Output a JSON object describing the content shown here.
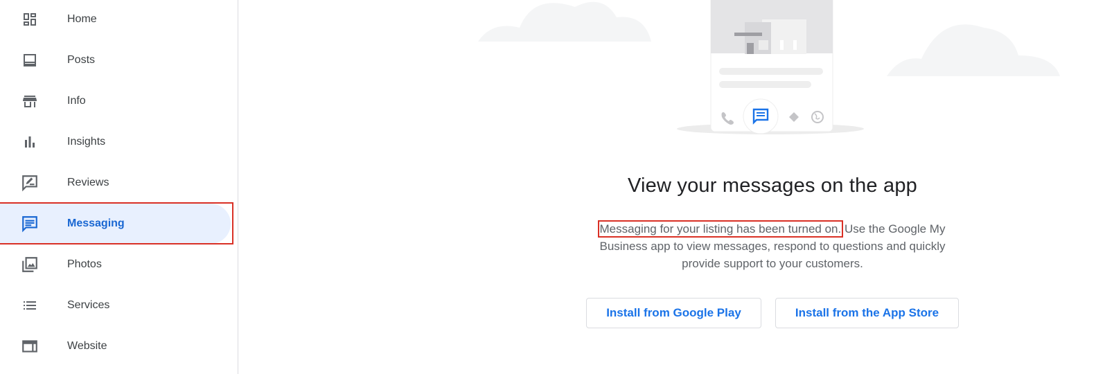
{
  "sidebar": {
    "items": [
      {
        "label": "Home",
        "icon": "dashboard-icon"
      },
      {
        "label": "Posts",
        "icon": "posts-icon"
      },
      {
        "label": "Info",
        "icon": "storefront-icon"
      },
      {
        "label": "Insights",
        "icon": "bar-chart-icon"
      },
      {
        "label": "Reviews",
        "icon": "rate-review-icon"
      },
      {
        "label": "Messaging",
        "icon": "chat-icon",
        "active": true
      },
      {
        "label": "Photos",
        "icon": "photo-library-icon"
      },
      {
        "label": "Services",
        "icon": "list-icon"
      },
      {
        "label": "Website",
        "icon": "web-icon"
      }
    ]
  },
  "main": {
    "title": "View your messages on the app",
    "body_highlight": "Messaging for your listing has been turned on.",
    "body_rest": " Use the Google My Business app to view messages, respond to questions and quickly provide support to your customers.",
    "buttons": {
      "google_play": "Install from Google Play",
      "app_store": "Install from the App Store"
    }
  },
  "colors": {
    "accent": "#1a73e8",
    "active_bg": "#e8f0fe",
    "highlight": "#d93025",
    "icon": "#5f6368"
  }
}
